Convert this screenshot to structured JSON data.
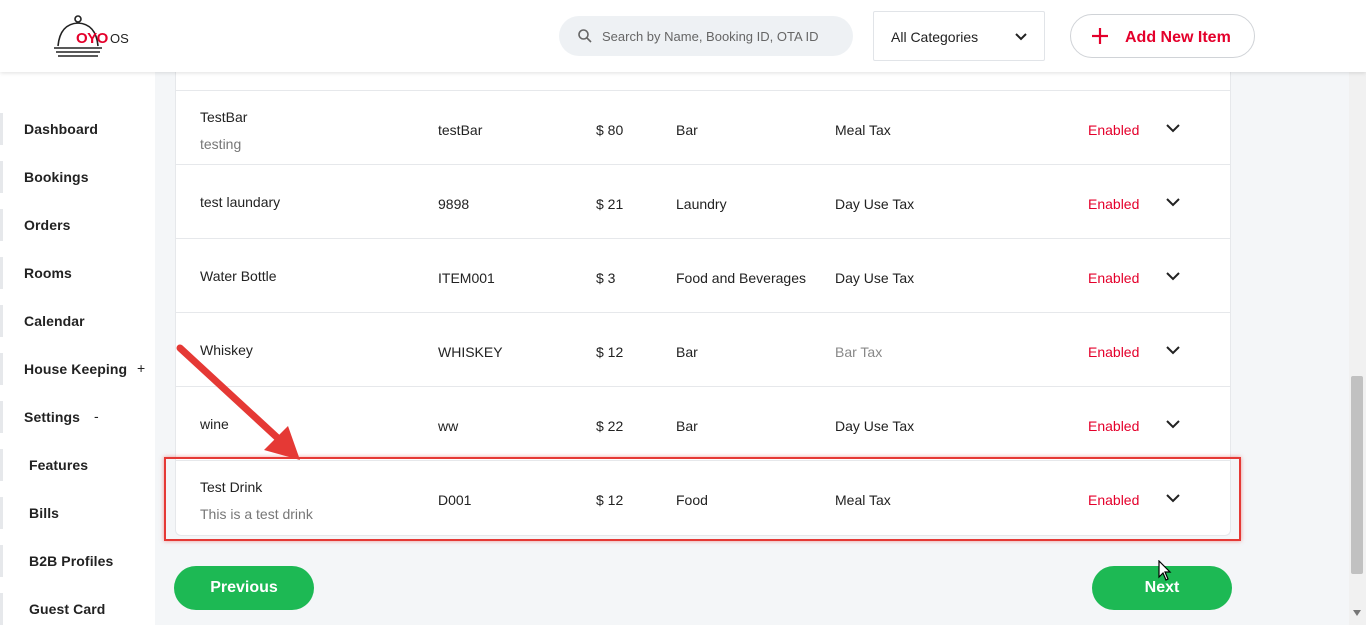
{
  "brand": {
    "logo_text": "OYO",
    "suffix": "OS"
  },
  "header": {
    "search_placeholder": "Search by Name, Booking ID, OTA ID",
    "category_selected": "All Categories",
    "add_button_label": "Add New Item"
  },
  "sidebar": {
    "items": [
      {
        "label": "Dashboard",
        "symbol": ""
      },
      {
        "label": "Bookings",
        "symbol": ""
      },
      {
        "label": "Orders",
        "symbol": ""
      },
      {
        "label": "Rooms",
        "symbol": ""
      },
      {
        "label": "Calendar",
        "symbol": ""
      },
      {
        "label": "House Keeping",
        "symbol": "+"
      },
      {
        "label": "Settings",
        "symbol": "-"
      },
      {
        "label": "Features",
        "symbol": ""
      },
      {
        "label": "Bills",
        "symbol": ""
      },
      {
        "label": "B2B Profiles",
        "symbol": ""
      },
      {
        "label": "Guest Card",
        "symbol": ""
      }
    ]
  },
  "table": {
    "rows": [
      {
        "name": "TestBar",
        "description": "testing",
        "code": "testBar",
        "price": "$ 80",
        "category": "Bar",
        "tax": "Meal Tax",
        "status": "Enabled"
      },
      {
        "name": "test laundary",
        "description": "",
        "code": "9898",
        "price": "$ 21",
        "category": "Laundry",
        "tax": "Day Use Tax",
        "status": "Enabled"
      },
      {
        "name": "Water Bottle",
        "description": "",
        "code": "ITEM001",
        "price": "$ 3",
        "category": "Food and Beverages",
        "tax": "Day Use Tax",
        "status": "Enabled"
      },
      {
        "name": "Whiskey",
        "description": "",
        "code": "WHISKEY",
        "price": "$ 12",
        "category": "Bar",
        "tax": "Bar Tax",
        "status": "Enabled"
      },
      {
        "name": "wine",
        "description": "",
        "code": "ww",
        "price": "$ 22",
        "category": "Bar",
        "tax": "Day Use Tax",
        "status": "Enabled"
      },
      {
        "name": "Test Drink",
        "description": "This is a test drink",
        "code": "D001",
        "price": "$ 12",
        "category": "Food",
        "tax": "Meal Tax",
        "status": "Enabled"
      }
    ]
  },
  "pagination": {
    "previous_label": "Previous",
    "next_label": "Next"
  },
  "colors": {
    "accent_red": "#e4002b",
    "green": "#1db954",
    "highlight": "#e53935"
  }
}
